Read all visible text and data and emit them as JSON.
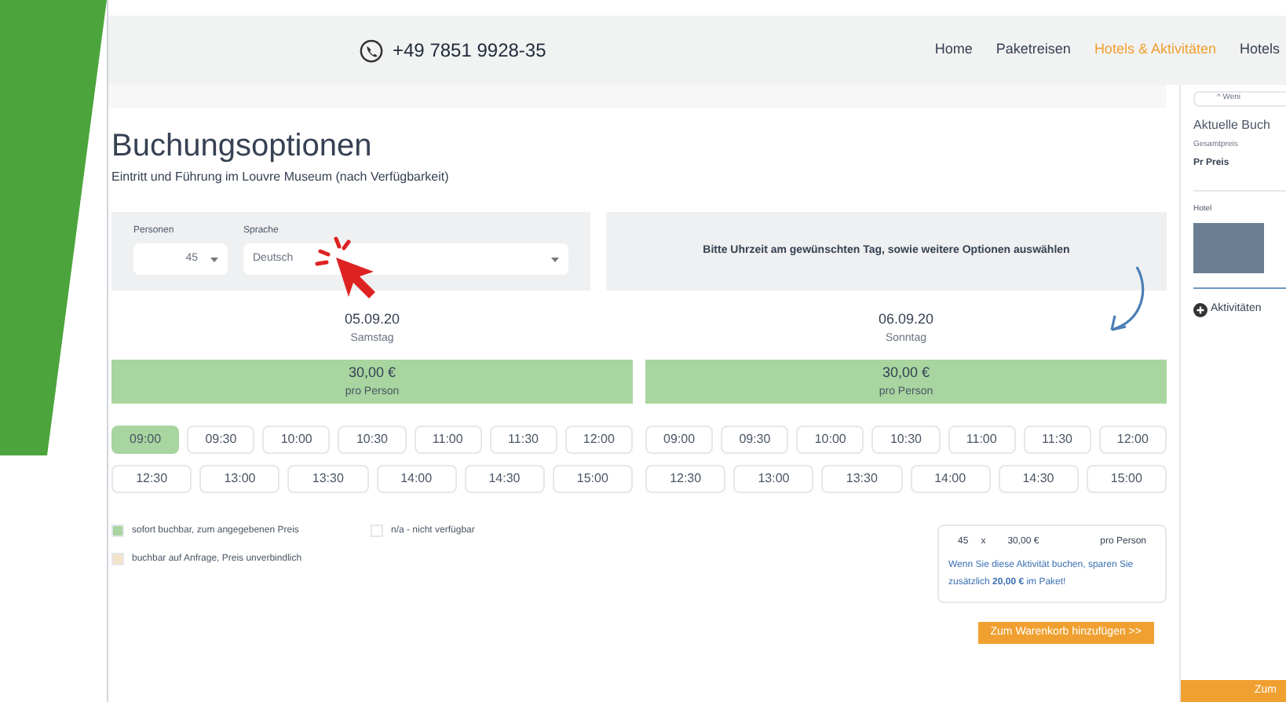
{
  "header": {
    "phone": "+49 7851 9928-35",
    "nav": [
      {
        "label": "Home",
        "selected": false
      },
      {
        "label": "Paketreisen",
        "selected": false
      },
      {
        "label": "Hotels & Aktivitäten",
        "selected": true
      },
      {
        "label": "Hotels",
        "selected": false
      }
    ]
  },
  "title": "Buchungsoptionen",
  "subtitle": "Eintritt und Führung im Louvre Museum (nach Verfügbarkeit)",
  "options": {
    "persons_label": "Personen",
    "persons_value": "45",
    "language_label": "Sprache",
    "language_value": "Deutsch",
    "hint": "Bitte Uhrzeit am gewünschten Tag, sowie weitere Optionen auswählen"
  },
  "days": [
    {
      "date": "05.09.20",
      "weekday": "Samstag",
      "price": "30,00 €",
      "per": "pro Person",
      "slots": [
        {
          "time": "09:00",
          "selected": true
        },
        {
          "time": "09:30",
          "selected": false
        },
        {
          "time": "10:00",
          "selected": false
        },
        {
          "time": "10:30",
          "selected": false
        },
        {
          "time": "11:00",
          "selected": false
        },
        {
          "time": "11:30",
          "selected": false
        },
        {
          "time": "12:00",
          "selected": false
        },
        {
          "time": "12:30",
          "selected": false
        },
        {
          "time": "13:00",
          "selected": false
        },
        {
          "time": "13:30",
          "selected": false
        },
        {
          "time": "14:00",
          "selected": false
        },
        {
          "time": "14:30",
          "selected": false
        },
        {
          "time": "15:00",
          "selected": false
        }
      ]
    },
    {
      "date": "06.09.20",
      "weekday": "Sonntag",
      "price": "30,00 €",
      "per": "pro Person",
      "slots": [
        {
          "time": "09:00",
          "selected": false
        },
        {
          "time": "09:30",
          "selected": false
        },
        {
          "time": "10:00",
          "selected": false
        },
        {
          "time": "10:30",
          "selected": false
        },
        {
          "time": "11:00",
          "selected": false
        },
        {
          "time": "11:30",
          "selected": false
        },
        {
          "time": "12:00",
          "selected": false
        },
        {
          "time": "12:30",
          "selected": false
        },
        {
          "time": "13:00",
          "selected": false
        },
        {
          "time": "13:30",
          "selected": false
        },
        {
          "time": "14:00",
          "selected": false
        },
        {
          "time": "14:30",
          "selected": false
        },
        {
          "time": "15:00",
          "selected": false
        }
      ]
    }
  ],
  "legend": [
    {
      "label": "sofort buchbar, zum angegebenen Preis",
      "color": "#a8d5a0"
    },
    {
      "label": "n/a - nicht verfügbar",
      "color": "#ffffff"
    },
    {
      "label": "buchbar auf Anfrage, Preis unverbindlich",
      "color": "#f3e3c8"
    }
  ],
  "summary": {
    "count": "45",
    "times": "x",
    "price": "30,00 €",
    "per": "pro Person",
    "note": "Wenn Sie diese Aktivität buchen, sparen Sie zusätzlich **20,00 €** im Paket!",
    "button": "Zum Warenkorb hinzufügen >>"
  },
  "sidebar": {
    "toggle": "^ Weni",
    "heading": "Aktuelle Buch",
    "total_label": "Gesamtpreis",
    "price_label": "Pr Preis",
    "hotel_label": "Hotel",
    "activities": "Aktivitäten",
    "button": "Zum"
  }
}
